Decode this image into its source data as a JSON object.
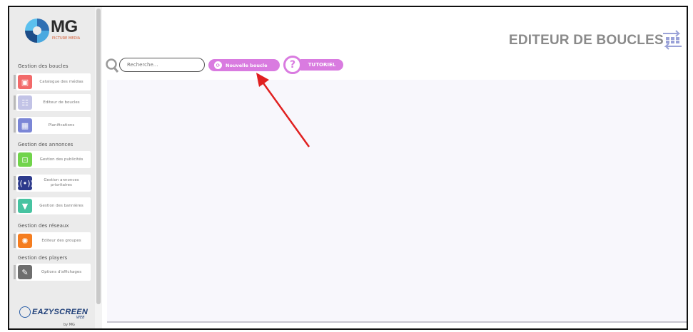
{
  "sidebar": {
    "logo": {
      "text": "MG",
      "subtitle": "PICTURE MEDIA"
    },
    "sections": [
      {
        "label": "Gestion des boucles"
      },
      {
        "label": "Gestion des annonces"
      },
      {
        "label": "Gestion des réseaux"
      },
      {
        "label": "Gestion des players"
      }
    ],
    "items": [
      {
        "label": "Catalogue des médias",
        "icon": "media-catalog-icon",
        "color": "#f26a6a"
      },
      {
        "label": "Editeur de boucles",
        "icon": "loop-editor-icon",
        "color": "#c2c3e6"
      },
      {
        "label": "Planifications",
        "icon": "calendar-icon",
        "color": "#7b86d6"
      },
      {
        "label": "Gestion des publicités",
        "icon": "advertising-icon",
        "color": "#71d44b"
      },
      {
        "label": "Gestion annonces prioritaires",
        "icon": "broadcast-icon",
        "color": "#2d3a8c"
      },
      {
        "label": "Gestion des bannières",
        "icon": "banner-icon",
        "color": "#47c3a1"
      },
      {
        "label": "Editeur des groupes",
        "icon": "groups-icon",
        "color": "#f57d1f"
      },
      {
        "label": "Options d'affichages",
        "icon": "brush-icon",
        "color": "#6e6e6e"
      }
    ],
    "brand": {
      "name": "EAZYSCREEN",
      "suffix": "WEB",
      "by": "by MG"
    }
  },
  "header": {
    "title": "EDITEUR DE BOUCLES"
  },
  "toolbar": {
    "search_placeholder": "Recherche...",
    "new_loop_label": "Nouvelle boucle",
    "tutorial_label": "TUTORIEL"
  },
  "colors": {
    "accent": "#d97be0",
    "arrow": "#e02020"
  }
}
